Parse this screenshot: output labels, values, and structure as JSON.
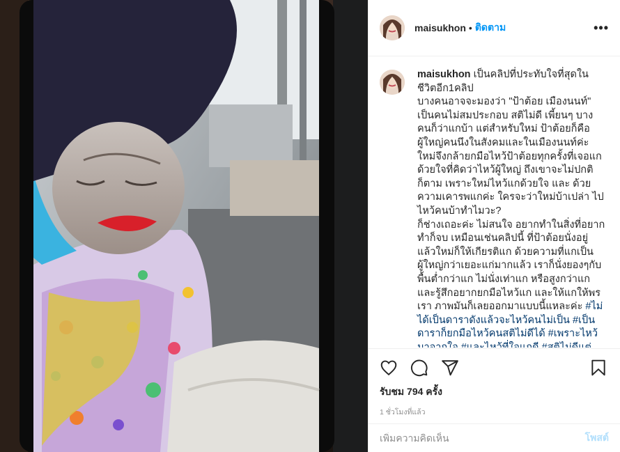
{
  "header": {
    "username": "maisukhon",
    "separator": "•",
    "follow_label": "ติดตาม",
    "more_label": "•••"
  },
  "caption": {
    "username": "maisukhon",
    "lines": [
      " เป็นคลิปที่ประทับใจที่สุดในชีวิตอีก1คลิป\nบางคนอาจจะมองว่า \"ป้าต้อย เมืองนนท์\" เป็นคนไม่สมประกอบ สติไม่ดี เพี้ยนๆ บางคนก็ว่าแกบ้า แต่สำหรับใหม่ ป้าต้อยก็คือผู้ใหญ่คนนึงในสังคมและในเมืองนนท์ค่ะ ใหม่จึงกล้ายกมือไหว้ป้าต้อยทุกครั้งที่เจอแก ด้วยใจที่คิดว่าไหว้ผู้ใหญ่ ถึงเขาจะไม่ปกติก็ตาม เพราะใหม่ไหว้แกด้วยใจ และ ด้วยความเคารพแกค่ะ ใครจะว่าใหม่บ้าเปล่า ไปไหว้คนบ้าทำไมวะ?\nก็ช่างเถอะค่ะ ไม่สนใจ อยากทำในสิ่งที่อยากทำก็จบ เหมือนเช่นคลิปนี้ ที่ป้าต้อยนั่งอยู่ แล้วใหม่ก็ให้เกียรติแก ด้วยความที่แกเป็นผู้ใหญ่กว่าเยอะแก่มากแล้ว เราก็นั่งยองๆกับพื้นต่ำกว่าแก ไม่นั่งเท่าแก หรือสูงกว่าแก และรู้สึกอยากยกมือไหว้แก และให้แกให้พรเรา ภาพมันก็เลยออกมาแบบนี้แหละค่ะ "
    ],
    "hashtags": "#ไม่ได้เป็นดาราดังแล้วจะไหว้คนไม่เป็น #เป็นดาราก็ยกมือไหว้คนสติไม่ดีได้ #เพราะไหว้มาจากใจ #และไหว้ที่ใจแกดี #สติไม่ดีแต่ใจดี #ป้าต้อยเมืองนนท์"
  },
  "actions": {
    "like": "heart-icon",
    "comment": "comment-icon",
    "share": "share-icon",
    "save": "bookmark-icon"
  },
  "likes_text": "รับชม 794 ครั้ง",
  "time_text": "1 ชั่วโมงที่แล้ว",
  "comment_box": {
    "placeholder": "เพิ่มความคิดเห็น",
    "post_label": "โพสต์"
  },
  "colors": {
    "follow": "#0095f6",
    "hashtag": "#00376b",
    "post_disabled": "#b2dffc",
    "muted": "#8e8e8e"
  }
}
